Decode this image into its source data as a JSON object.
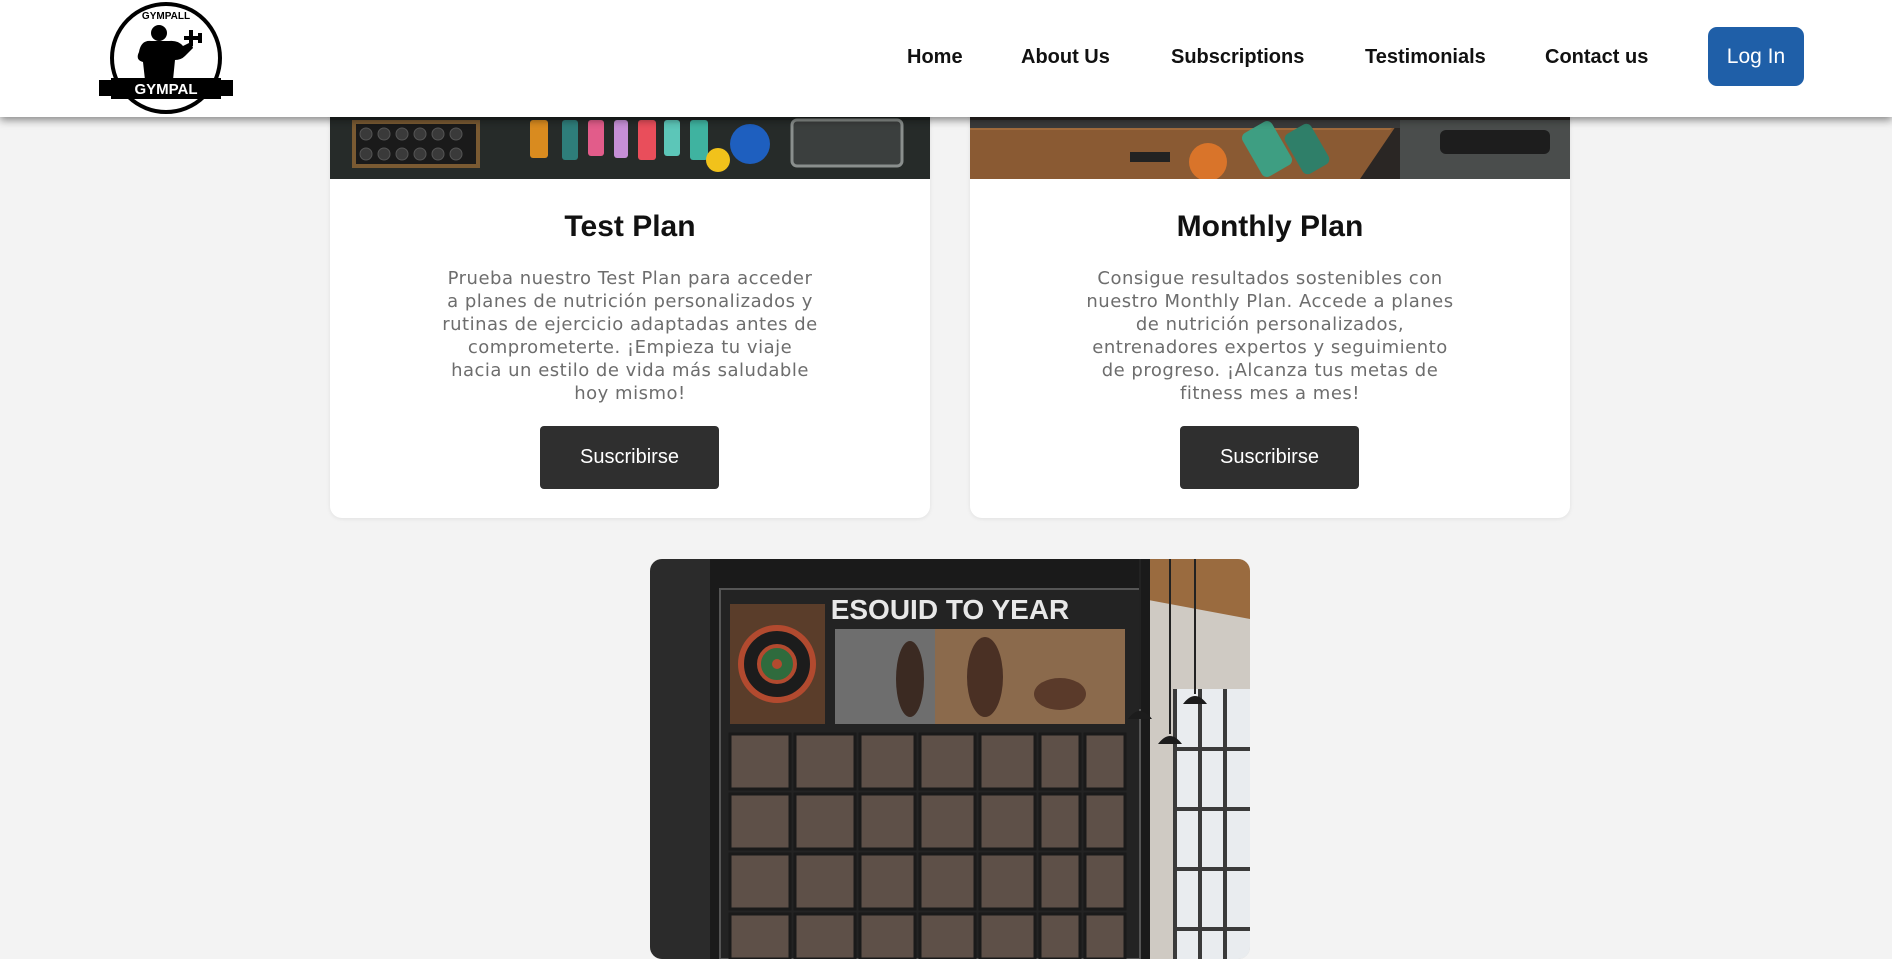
{
  "header": {
    "logo_top_text": "GYMPALL",
    "logo_banner_text": "GYMPAL",
    "nav": [
      {
        "label": "Home"
      },
      {
        "label": "About Us"
      },
      {
        "label": "Subscriptions"
      },
      {
        "label": "Testimonials"
      },
      {
        "label": "Contact us"
      }
    ],
    "login_label": "Log In"
  },
  "plans": [
    {
      "title": "Test Plan",
      "description": "Prueba nuestro Test Plan para acceder a planes de nutrición personalizados y rutinas de ejercicio adaptadas antes de comprometerte. ¡Empieza tu viaje hacia un estilo de vida más saludable hoy mismo!",
      "button_label": "Suscribirse"
    },
    {
      "title": "Monthly Plan",
      "description": "Consigue resultados sostenibles con nuestro Monthly Plan. Accede a planes de nutrición personalizados, entrenadores expertos y seguimiento de progreso. ¡Alcanza tus metas de fitness mes a mes!",
      "button_label": "Suscribirse"
    }
  ],
  "yearly_image": {
    "board_title": "ESOUID TO YEAR"
  },
  "colors": {
    "page_bg": "#f3f3f3",
    "login_button": "#1f5fa8",
    "subscribe_button": "#2f2f2f"
  }
}
